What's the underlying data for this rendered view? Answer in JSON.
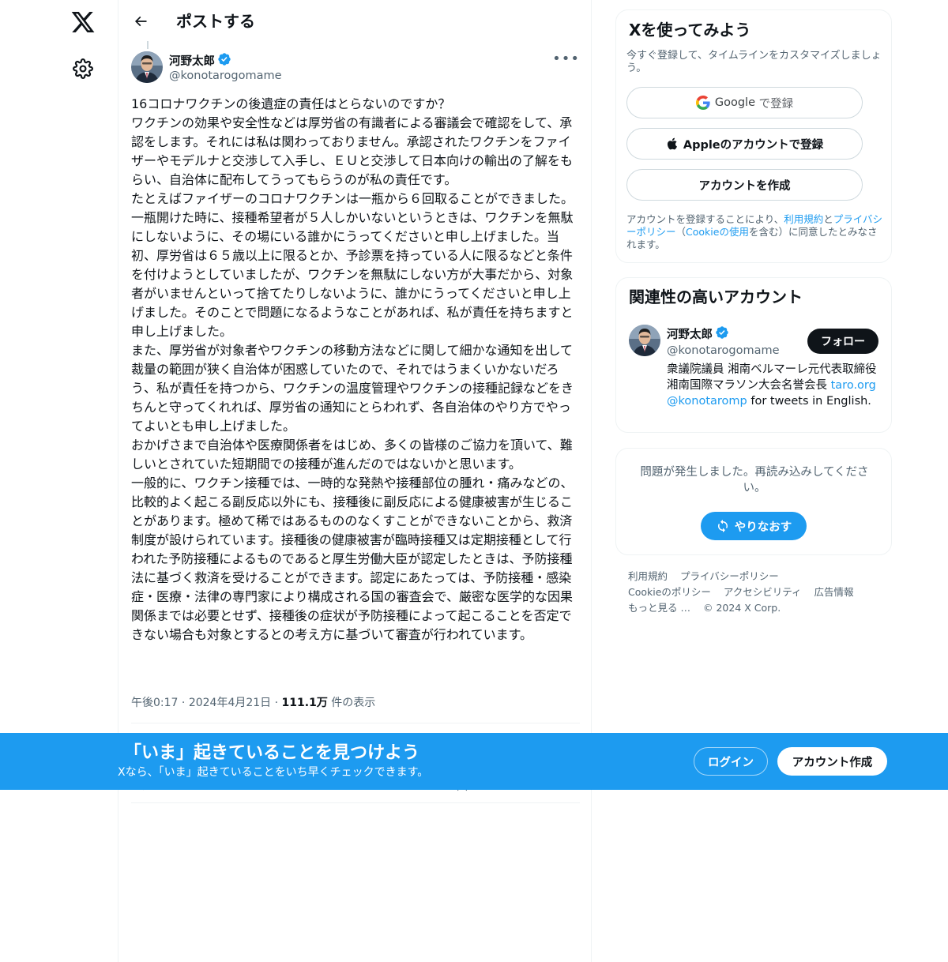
{
  "header": {
    "title": "ポストする"
  },
  "tweet": {
    "author_name": "河野太郎",
    "author_handle": "@konotarogomame",
    "text": "16コロナワクチンの後遺症の責任はとらないのですか？\nワクチンの効果や安全性などは厚労省の有識者による審議会で確認をして、承認をします。それには私は関わっておりません。承認されたワクチンをファイザーやモデルナと交渉して入手し、ＥＵと交渉して日本向けの輸出の了解をもらい、自治体に配布してうってもらうのが私の責任です。\nたとえばファイザーのコロナワクチンは一瓶から６回取ることができました。一瓶開けた時に、接種希望者が５人しかいないというときは、ワクチンを無駄にしないように、その場にいる誰かにうってくださいと申し上げました。当初、厚労省は６５歳以上に限るとか、予診票を持っている人に限るなどと条件を付けようとしていましたが、ワクチンを無駄にしない方が大事だから、対象者がいませんといって捨てたりしないように、誰かにうってくださいと申し上げました。そのことで問題になるようなことがあれば、私が責任を持ちますと申し上げました。\nまた、厚労省が対象者やワクチンの移動方法などに関して細かな通知を出して裁量の範囲が狭く自治体が困惑していたので、それではうまくいかないだろう、私が責任を持つから、ワクチンの温度管理やワクチンの接種記録などをきちんと守ってくれれば、厚労省の通知にとらわれず、各自治体のやり方でやってよいとも申し上げました。\nおかげさまで自治体や医療関係者をはじめ、多くの皆様のご協力を頂いて、難しいとされていた短期間での接種が進んだのではないかと思います。\n一般的に、ワクチン接種では、一時的な発熱や接種部位の腫れ・痛みなどの、比較的よく起こる副反応以外にも、接種後に副反応による健康被害が生じることがあります。極めて稀ではあるもののなくすことができないことから、救済制度が設けられています。接種後の健康被害が臨時接種又は定期接種として行われた予防接種によるものであると厚生労働大臣が認定したときは、予防接種法に基づく救済を受けることができます。認定にあたっては、予防接種・感染症・医療・法律の専門家により構成される国の審査会で、厳密な医学的な因果関係までは必要とせず、接種後の症状が予防接種によって起こることを否定できない場合も対象とするとの考え方に基づいて審査が行われています。",
    "time": "午後0:17",
    "date": "2024年4月21日",
    "views": "111.1万",
    "views_suffix": "件の表示"
  },
  "signup_card": {
    "title": "Xを使ってみよう",
    "subtitle": "今すぐ登録して、タイムラインをカスタマイズしましょう。",
    "google_brand": "Google",
    "google_suffix": "で登録",
    "apple_label": "Appleのアカウントで登録",
    "create_label": "アカウントを作成",
    "terms_prefix": "アカウントを登録することにより、",
    "terms_link1": "利用規約",
    "terms_and": "と",
    "terms_link2": "プライバシーポリシー",
    "terms_paren_open": "（",
    "terms_link3": "Cookieの使用",
    "terms_suffix": "を含む）に同意したとみなされます。"
  },
  "related_card": {
    "title": "関連性の高いアカウント",
    "name": "河野太郎",
    "handle": "@konotarogomame",
    "follow_label": "フォロー",
    "bio_text": "衆議院議員 湘南ベルマーレ元代表取締役 湘南国際マラソン大会名誉会長 ",
    "bio_link1": "taro.org",
    "bio_link2": "@konotaromp",
    "bio_tail": " for tweets in English."
  },
  "error_card": {
    "message": "問題が発生しました。再読み込みしてください。",
    "retry_label": "やりなおす"
  },
  "footer": {
    "terms": "利用規約",
    "privacy": "プライバシーポリシー",
    "cookie": "Cookieのポリシー",
    "accessibility": "アクセシビリティ",
    "ads": "広告情報",
    "more": "もっと見る …",
    "copyright": "© 2024 X Corp."
  },
  "banner": {
    "title": "「いま」起きていることを見つけよう",
    "subtitle": "Xなら、「いま」起きていることをいち早くチェックできます。",
    "login_label": "ログイン",
    "signup_label": "アカウント作成"
  },
  "colors": {
    "accent": "#1d9bf0",
    "text": "#0f1419",
    "secondary": "#536471",
    "border": "#eff3f4"
  }
}
